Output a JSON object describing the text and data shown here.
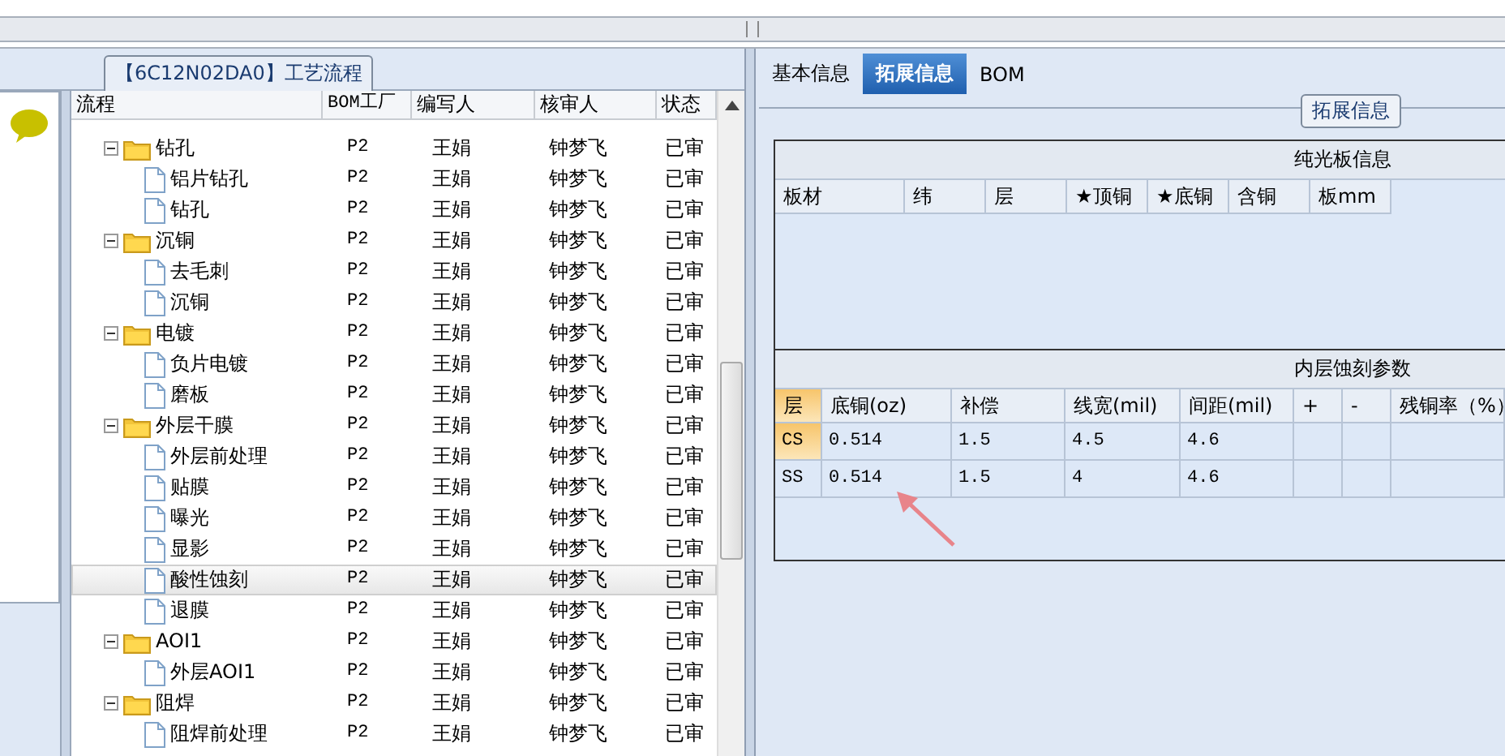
{
  "flow_group": {
    "title": "【6C12N02DA0】工艺流程"
  },
  "tree": {
    "columns": [
      "流程",
      "BOM工厂",
      "编写人",
      "核审人",
      "状态"
    ],
    "rows": [
      {
        "name": "钻孔",
        "factory": "P2",
        "writer": "王娟",
        "reviewer": "钟梦飞",
        "status": "已审",
        "expanded": true,
        "selected": false,
        "children": [
          {
            "name": "铝片钻孔",
            "factory": "P2",
            "writer": "王娟",
            "reviewer": "钟梦飞",
            "status": "已审",
            "selected": false
          },
          {
            "name": "钻孔",
            "factory": "P2",
            "writer": "王娟",
            "reviewer": "钟梦飞",
            "status": "已审",
            "selected": false
          }
        ]
      },
      {
        "name": "沉铜",
        "factory": "P2",
        "writer": "王娟",
        "reviewer": "钟梦飞",
        "status": "已审",
        "expanded": true,
        "selected": false,
        "children": [
          {
            "name": "去毛刺",
            "factory": "P2",
            "writer": "王娟",
            "reviewer": "钟梦飞",
            "status": "已审",
            "selected": false
          },
          {
            "name": "沉铜",
            "factory": "P2",
            "writer": "王娟",
            "reviewer": "钟梦飞",
            "status": "已审",
            "selected": false
          }
        ]
      },
      {
        "name": "电镀",
        "factory": "P2",
        "writer": "王娟",
        "reviewer": "钟梦飞",
        "status": "已审",
        "expanded": true,
        "selected": false,
        "children": [
          {
            "name": "负片电镀",
            "factory": "P2",
            "writer": "王娟",
            "reviewer": "钟梦飞",
            "status": "已审",
            "selected": false
          },
          {
            "name": "磨板",
            "factory": "P2",
            "writer": "王娟",
            "reviewer": "钟梦飞",
            "status": "已审",
            "selected": false
          }
        ]
      },
      {
        "name": "外层干膜",
        "factory": "P2",
        "writer": "王娟",
        "reviewer": "钟梦飞",
        "status": "已审",
        "expanded": true,
        "selected": false,
        "children": [
          {
            "name": "外层前处理",
            "factory": "P2",
            "writer": "王娟",
            "reviewer": "钟梦飞",
            "status": "已审",
            "selected": false
          },
          {
            "name": "贴膜",
            "factory": "P2",
            "writer": "王娟",
            "reviewer": "钟梦飞",
            "status": "已审",
            "selected": false
          },
          {
            "name": "曝光",
            "factory": "P2",
            "writer": "王娟",
            "reviewer": "钟梦飞",
            "status": "已审",
            "selected": false
          },
          {
            "name": "显影",
            "factory": "P2",
            "writer": "王娟",
            "reviewer": "钟梦飞",
            "status": "已审",
            "selected": false
          },
          {
            "name": "酸性蚀刻",
            "factory": "P2",
            "writer": "王娟",
            "reviewer": "钟梦飞",
            "status": "已审",
            "selected": true
          },
          {
            "name": "退膜",
            "factory": "P2",
            "writer": "王娟",
            "reviewer": "钟梦飞",
            "status": "已审",
            "selected": false
          }
        ]
      },
      {
        "name": "AOI1",
        "factory": "P2",
        "writer": "王娟",
        "reviewer": "钟梦飞",
        "status": "已审",
        "expanded": true,
        "selected": false,
        "children": [
          {
            "name": "外层AOI1",
            "factory": "P2",
            "writer": "王娟",
            "reviewer": "钟梦飞",
            "status": "已审",
            "selected": false
          }
        ]
      },
      {
        "name": "阻焊",
        "factory": "P2",
        "writer": "王娟",
        "reviewer": "钟梦飞",
        "status": "已审",
        "expanded": true,
        "selected": false,
        "children": [
          {
            "name": "阻焊前处理",
            "factory": "P2",
            "writer": "王娟",
            "reviewer": "钟梦飞",
            "status": "已审",
            "selected": false
          }
        ]
      }
    ]
  },
  "tabs": [
    {
      "label": "基本信息",
      "selected": false
    },
    {
      "label": "拓展信息",
      "selected": true
    },
    {
      "label": "BOM",
      "selected": false
    }
  ],
  "ext_group": {
    "title": "拓展信息"
  },
  "board_section": {
    "title": "纯光板信息",
    "columns": [
      "板材",
      "纬",
      "层",
      "★顶铜",
      "★底铜",
      "含铜",
      "板mm"
    ]
  },
  "etch_section": {
    "title": "内层蚀刻参数",
    "columns": [
      "层",
      "底铜(oz)",
      "补偿",
      "线宽(mil)",
      "间距(mil)",
      "+",
      "-",
      "残铜率（%）"
    ],
    "rows": [
      {
        "cells": [
          "CS",
          "0.514",
          "1.5",
          "4.5",
          "4.6"
        ],
        "selected": true
      },
      {
        "cells": [
          "SS",
          "0.514",
          "1.5",
          "4",
          "4.6"
        ],
        "selected": false
      }
    ]
  }
}
